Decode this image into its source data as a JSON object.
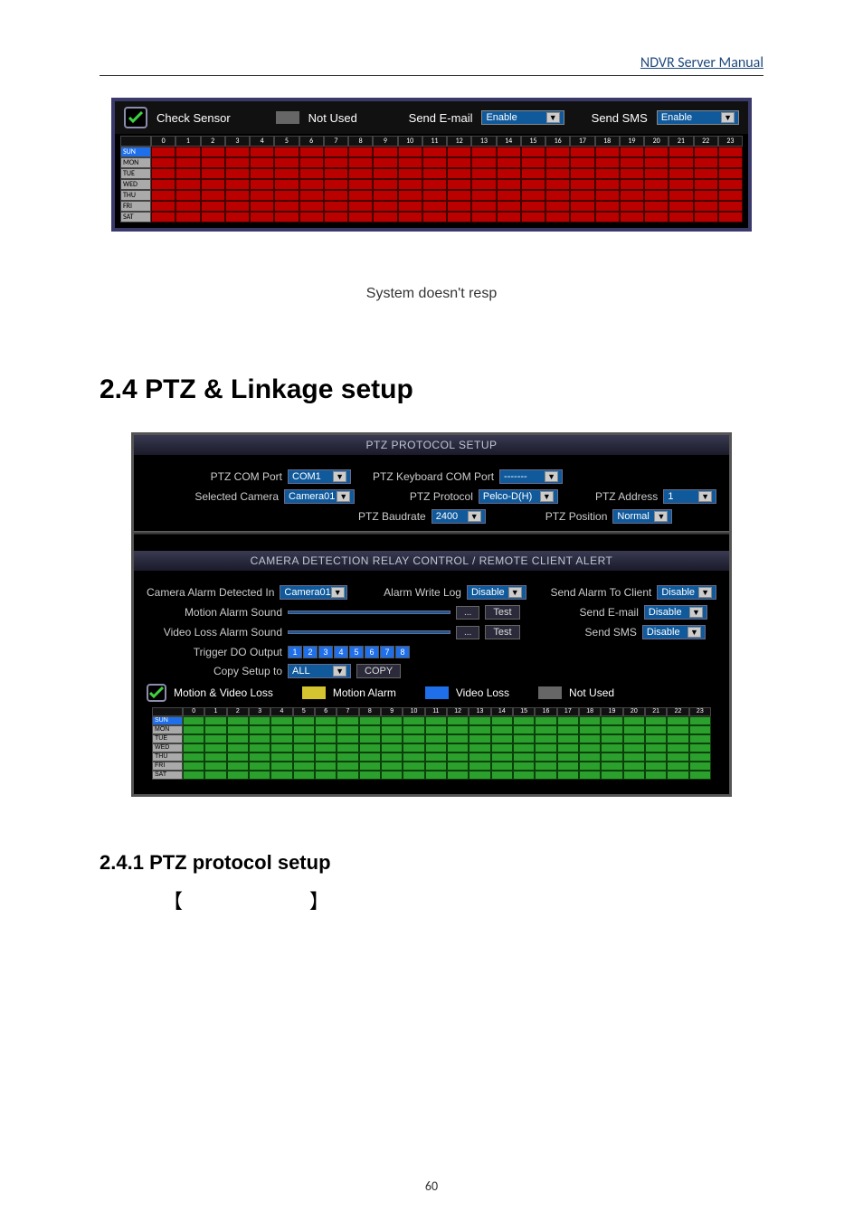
{
  "header_link": "NDVR Server Manual",
  "figure1": {
    "legend": {
      "check_sensor": "Check Sensor",
      "not_used": "Not Used",
      "send_email": "Send E-mail",
      "send_sms": "Send SMS"
    },
    "email_value": "Enable",
    "sms_value": "Enable",
    "hours": [
      "0",
      "1",
      "2",
      "3",
      "4",
      "5",
      "6",
      "7",
      "8",
      "9",
      "10",
      "11",
      "12",
      "13",
      "14",
      "15",
      "16",
      "17",
      "18",
      "19",
      "20",
      "21",
      "22",
      "23"
    ],
    "days": [
      "SUN",
      "MON",
      "TUE",
      "WED",
      "THU",
      "FRI",
      "SAT"
    ]
  },
  "caption": "System doesn't resp",
  "h2_num": "2.4",
  "h2_text": "PTZ & Linkage setup",
  "figure2": {
    "title1": "PTZ PROTOCOL SETUP",
    "ptz_com_port_label": "PTZ COM Port",
    "ptz_com_port_value": "COM1",
    "ptz_kb_com_port_label": "PTZ Keyboard COM Port",
    "ptz_kb_com_port_value": "-------",
    "selected_camera_label": "Selected Camera",
    "selected_camera_value": "Camera01",
    "ptz_protocol_label": "PTZ Protocol",
    "ptz_protocol_value": "Pelco-D(H)",
    "ptz_address_label": "PTZ Address",
    "ptz_address_value": "1",
    "ptz_baudrate_label": "PTZ Baudrate",
    "ptz_baudrate_value": "2400",
    "ptz_position_label": "PTZ Position",
    "ptz_position_value": "Normal",
    "title2": "CAMERA DETECTION RELAY CONTROL / REMOTE CLIENT ALERT",
    "cam_alarm_detect_label": "Camera Alarm Detected In",
    "cam_alarm_detect_value": "Camera01",
    "alarm_write_log_label": "Alarm Write Log",
    "alarm_write_log_value": "Disable",
    "send_alarm_client_label": "Send Alarm To Client",
    "send_alarm_client_value": "Disable",
    "motion_alarm_sound_label": "Motion Alarm Sound",
    "test_button": "Test",
    "browse_button": "...",
    "send_email_label": "Send E-mail",
    "send_email_value": "Disable",
    "video_loss_sound_label": "Video Loss Alarm Sound",
    "send_sms_label": "Send SMS",
    "send_sms_value": "Disable",
    "trigger_do_label": "Trigger DO Output",
    "trigger_do_nums": [
      "1",
      "2",
      "3",
      "4",
      "5",
      "6",
      "7",
      "8"
    ],
    "copy_setup_label": "Copy Setup to",
    "copy_setup_value": "ALL",
    "copy_button": "COPY",
    "legend": {
      "motion_video_loss": "Motion & Video Loss",
      "motion_alarm": "Motion Alarm",
      "video_loss": "Video Loss",
      "not_used": "Not Used"
    },
    "hours": [
      "0",
      "1",
      "2",
      "3",
      "4",
      "5",
      "6",
      "7",
      "8",
      "9",
      "10",
      "11",
      "12",
      "13",
      "14",
      "15",
      "16",
      "17",
      "18",
      "19",
      "20",
      "21",
      "22",
      "23"
    ],
    "days": [
      "SUN",
      "MON",
      "TUE",
      "WED",
      "THU",
      "FRI",
      "SAT"
    ]
  },
  "h3_num": "2.4.1",
  "h3_text": "PTZ protocol setup",
  "bracket_open": "【",
  "bracket_close": "】",
  "page_number": "60"
}
